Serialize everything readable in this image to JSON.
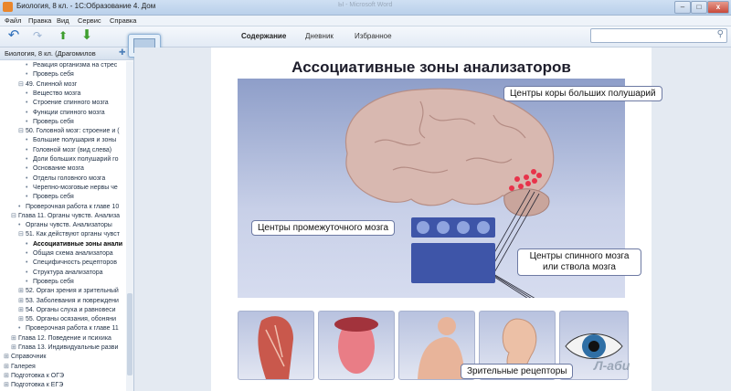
{
  "window": {
    "title": "Биология, 8 кл. - 1С:Образование 4. Дом",
    "faded_title": "Ы - Microsoft Word",
    "controls": {
      "minimize": "–",
      "maximize": "□",
      "close": "x"
    }
  },
  "menu": [
    "Файл",
    "Правка",
    "Вид",
    "Сервис",
    "Справка"
  ],
  "toolbar": {
    "icons": [
      "back-arrow-icon",
      "forward-arrow-icon",
      "up-arrow-icon",
      "down-arrow-icon"
    ],
    "tabs": [
      {
        "label": "Содержание",
        "active": true
      },
      {
        "label": "Дневник",
        "active": false
      },
      {
        "label": "Избранное",
        "active": false
      }
    ],
    "search_placeholder": ""
  },
  "sidebar": {
    "title": "Биология, 8 кл. (Драгомилов",
    "items": [
      {
        "marker": "•",
        "level": 3,
        "label": "Реакция организма на стрес"
      },
      {
        "marker": "•",
        "level": 3,
        "label": "Проверь себя"
      },
      {
        "marker": "⊟",
        "level": 2,
        "label": "49. Спинной мозг"
      },
      {
        "marker": "•",
        "level": 3,
        "label": "Вещество мозга"
      },
      {
        "marker": "•",
        "level": 3,
        "label": "Строение спинного мозга"
      },
      {
        "marker": "•",
        "level": 3,
        "label": "Функции спинного мозга"
      },
      {
        "marker": "•",
        "level": 3,
        "label": "Проверь себя"
      },
      {
        "marker": "⊟",
        "level": 2,
        "label": "50. Головной мозг: строение и ("
      },
      {
        "marker": "•",
        "level": 3,
        "label": "Большие полушария и зоны"
      },
      {
        "marker": "•",
        "level": 3,
        "label": "Головной мозг (вид слева)"
      },
      {
        "marker": "•",
        "level": 3,
        "label": "Доли больших полушарий го"
      },
      {
        "marker": "•",
        "level": 3,
        "label": "Основание мозга"
      },
      {
        "marker": "•",
        "level": 3,
        "label": "Отделы головного мозга"
      },
      {
        "marker": "•",
        "level": 3,
        "label": "Черепно-мозговые нервы че"
      },
      {
        "marker": "•",
        "level": 3,
        "label": "Проверь себя"
      },
      {
        "marker": "•",
        "level": 2,
        "label": "Проверочная работа к главе 10"
      },
      {
        "marker": "⊟",
        "level": 1,
        "label": "Глава 11. Органы чувств. Анализа"
      },
      {
        "marker": "•",
        "level": 2,
        "label": "Органы чувств. Анализаторы"
      },
      {
        "marker": "⊟",
        "level": 2,
        "label": "51. Как действуют органы чувст"
      },
      {
        "marker": "•",
        "level": 3,
        "label": "Ассоциативные зоны анали",
        "selected": true
      },
      {
        "marker": "•",
        "level": 3,
        "label": "Общая схема анализатора"
      },
      {
        "marker": "•",
        "level": 3,
        "label": "Специфичность рецепторов"
      },
      {
        "marker": "•",
        "level": 3,
        "label": "Структура анализатора"
      },
      {
        "marker": "•",
        "level": 3,
        "label": "Проверь себя"
      },
      {
        "marker": "⊞",
        "level": 2,
        "label": "52. Орган зрения и зрительный"
      },
      {
        "marker": "⊞",
        "level": 2,
        "label": "53. Заболевания и повреждени"
      },
      {
        "marker": "⊞",
        "level": 2,
        "label": "54. Органы слуха и равновеси"
      },
      {
        "marker": "⊞",
        "level": 2,
        "label": "55. Органы осязания, обоняни"
      },
      {
        "marker": "•",
        "level": 2,
        "label": "Проверочная работа к главе 11"
      },
      {
        "marker": "⊞",
        "level": 1,
        "label": "Глава 12. Поведение и психика"
      },
      {
        "marker": "⊞",
        "level": 1,
        "label": "Глава 13. Индивидуальные разви"
      },
      {
        "marker": "⊞",
        "level": 0,
        "label": "Справочник"
      },
      {
        "marker": "⊞",
        "level": 0,
        "label": "Галерея"
      },
      {
        "marker": "⊞",
        "level": 0,
        "label": "Подготовка к ОГЭ"
      },
      {
        "marker": "⊞",
        "level": 0,
        "label": "Подготовка к ЕГЭ"
      }
    ]
  },
  "lesson": {
    "title": "Ассоциативные зоны анализаторов",
    "labels": {
      "cortex": "Центры коры больших полушарий",
      "diencephalon": "Центры промежуточного мозга",
      "spinal": "Центры спинного мозга или ствола мозга",
      "receptors": "Зрительные рецепторы"
    },
    "thumbnails": [
      "muscles-image",
      "tongue-image",
      "skin-image",
      "ear-image",
      "eye-image"
    ]
  },
  "watermark": "Л-аби",
  "colors": {
    "accent": "#3e55a8",
    "brain": "#d7b9b1",
    "highlight": "#e8334a"
  }
}
